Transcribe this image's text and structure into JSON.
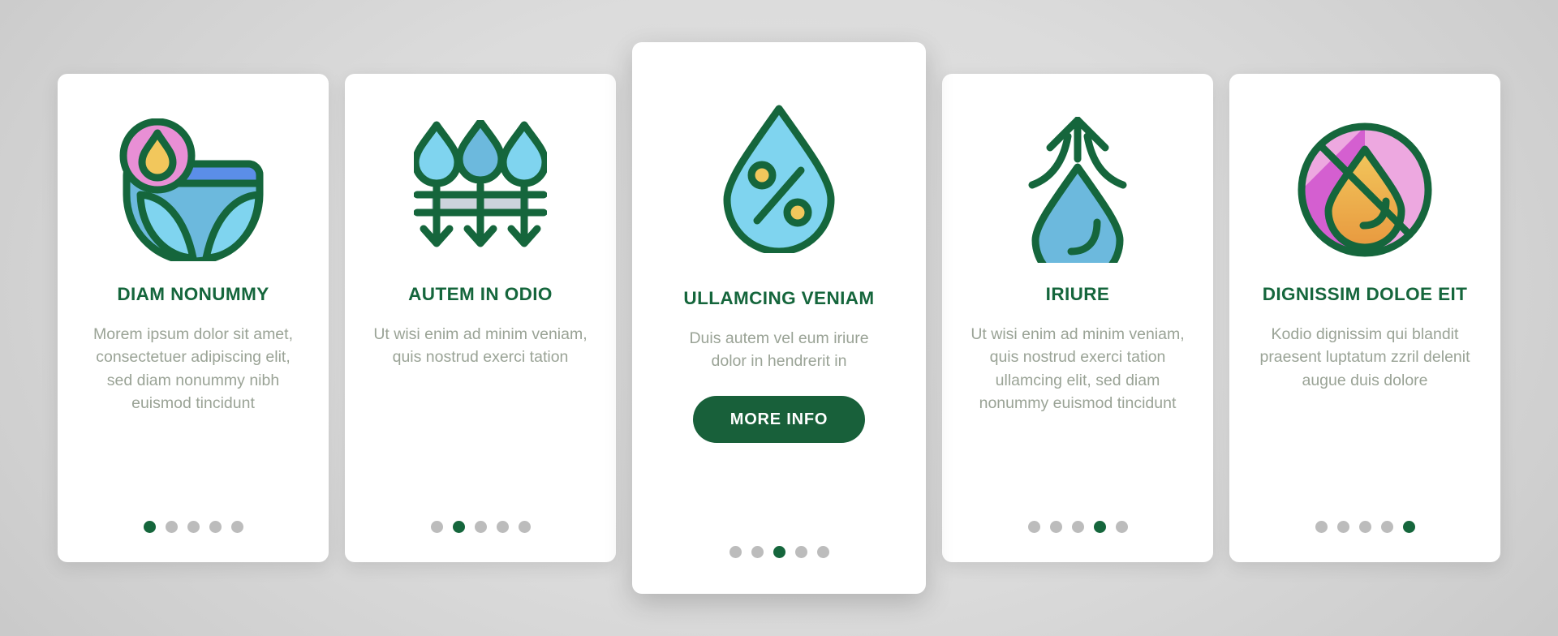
{
  "colors": {
    "brand_green": "#15663c",
    "button_green": "#18603a",
    "body_text": "#9aa396",
    "dot_inactive": "#bcbcbc",
    "card_bg": "#ffffff",
    "page_bg": "#d9d9d9",
    "icon_blue_light": "#7fd4ef",
    "icon_blue_mid": "#6cb9dd",
    "icon_blue_dark": "#5b8ee8",
    "icon_pink": "#e88fd5",
    "icon_pink_light": "#eda8e0",
    "icon_magenta": "#d45fd0",
    "icon_yellow": "#f2c75c",
    "icon_orange": "#e8993f",
    "icon_grey": "#ccd3dc"
  },
  "cards": [
    {
      "icon": "diaper-drop-icon",
      "title": "DIAM NONUMMY",
      "body": "Morem ipsum dolor sit amet, consectetuer adipiscing elit, sed diam nonummy nibh euismod tincidunt",
      "featured": false,
      "dots": {
        "count": 5,
        "active": 0
      }
    },
    {
      "icon": "drops-through-fabric-icon",
      "title": "AUTEM IN ODIO",
      "body": "Ut wisi enim ad minim veniam, quis nostrud exerci tation",
      "featured": false,
      "dots": {
        "count": 5,
        "active": 1
      }
    },
    {
      "icon": "humidity-percent-drop-icon",
      "title": "ULLAMCING VENIAM",
      "body": "Duis autem vel eum iriure dolor in hendrerit in",
      "featured": true,
      "button_label": "MORE INFO",
      "dots": {
        "count": 5,
        "active": 2
      }
    },
    {
      "icon": "evaporating-drop-icon",
      "title": "IRIURE",
      "body": "Ut wisi enim ad minim veniam, quis nostrud exerci tation ullamcing elit, sed diam nonummy euismod tincidunt",
      "featured": false,
      "dots": {
        "count": 5,
        "active": 3
      }
    },
    {
      "icon": "no-moisture-drop-icon",
      "title": "DIGNISSIM DOLOE EIT",
      "body": "Kodio dignissim qui blandit praesent luptatum zzril delenit augue duis dolore",
      "featured": false,
      "dots": {
        "count": 5,
        "active": 4
      }
    }
  ]
}
